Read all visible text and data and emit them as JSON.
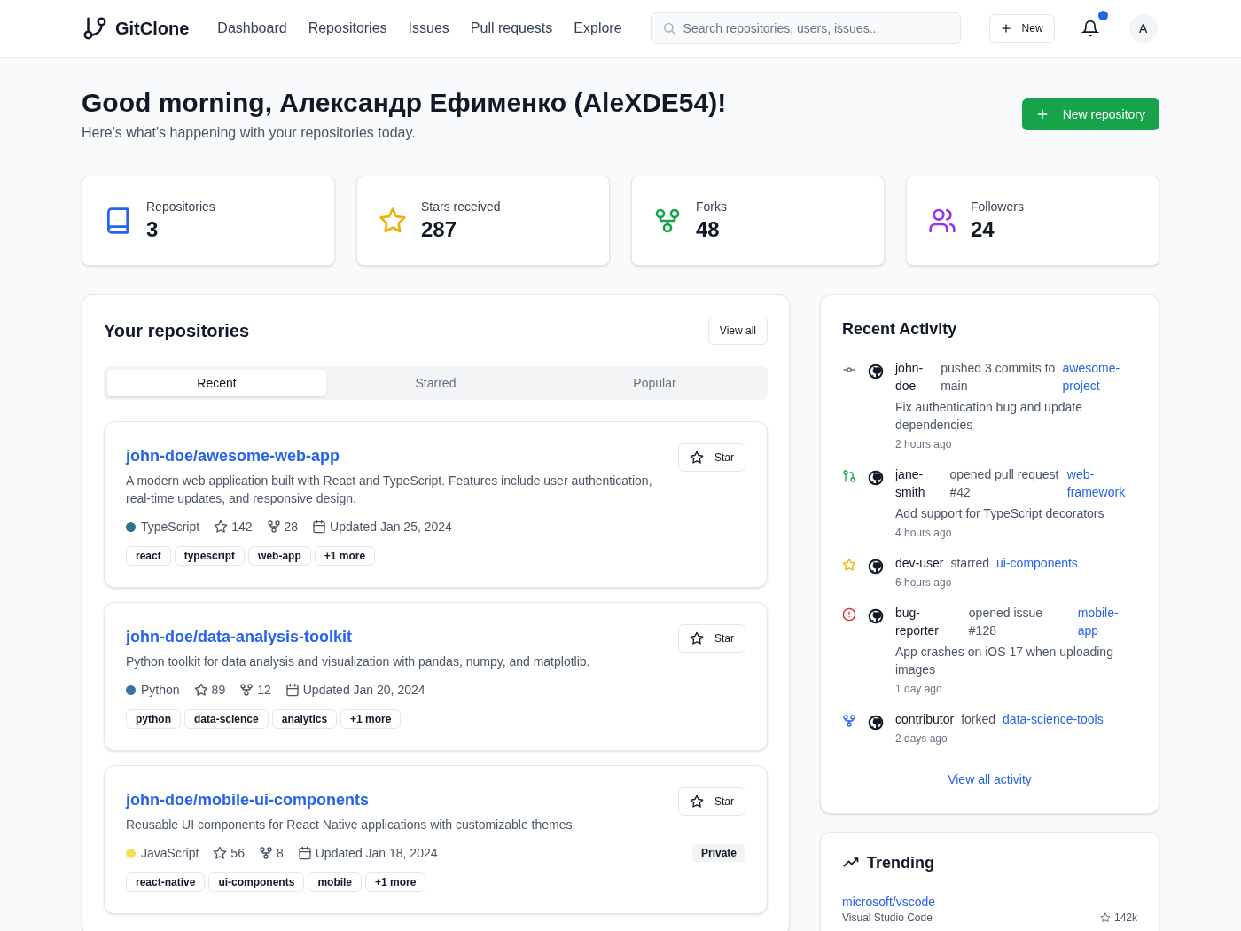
{
  "header": {
    "brand": "GitClone",
    "nav": [
      {
        "label": "Dashboard"
      },
      {
        "label": "Repositories"
      },
      {
        "label": "Issues"
      },
      {
        "label": "Pull requests"
      },
      {
        "label": "Explore"
      }
    ],
    "search": {
      "placeholder": "Search repositories, users, issues..."
    },
    "new_button": "New",
    "notifications": {
      "unread": true
    },
    "avatar": "A"
  },
  "greeting": {
    "title": "Good morning, Александр Ефименко (AleXDE54)!",
    "subtitle": "Here's what's happening with your repositories today.",
    "new_repo_button": "New repository"
  },
  "stats": [
    {
      "kind": "book",
      "label": "Repositories",
      "value": "3",
      "color": "#2563eb"
    },
    {
      "kind": "star",
      "label": "Stars received",
      "value": "287",
      "color": "#eab308"
    },
    {
      "kind": "fork",
      "label": "Forks",
      "value": "48",
      "color": "#16a34a"
    },
    {
      "kind": "users",
      "label": "Followers",
      "value": "24",
      "color": "#9333ea"
    }
  ],
  "repositories": {
    "title": "Your repositories",
    "view_all": "View all",
    "tabs": [
      {
        "label": "Recent",
        "selected": true
      },
      {
        "label": "Starred",
        "selected": false
      },
      {
        "label": "Popular",
        "selected": false
      }
    ],
    "items": [
      {
        "name": "john-doe/awesome-web-app",
        "description": "A modern web application built with React and TypeScript. Features include user authentication, real-time updates, and responsive design.",
        "star_button": "Star",
        "language": "TypeScript",
        "color": "#2b7489",
        "stars": "142",
        "forks": "28",
        "updated": "Updated Jan 25, 2024",
        "private": false,
        "topics": [
          "react",
          "typescript",
          "web-app",
          "+1 more"
        ]
      },
      {
        "name": "john-doe/data-analysis-toolkit",
        "description": "Python toolkit for data analysis and visualization with pandas, numpy, and matplotlib.",
        "star_button": "Star",
        "language": "Python",
        "color": "#3572a5",
        "stars": "89",
        "forks": "12",
        "updated": "Updated Jan 20, 2024",
        "private": false,
        "topics": [
          "python",
          "data-science",
          "analytics",
          "+1 more"
        ]
      },
      {
        "name": "john-doe/mobile-ui-components",
        "description": "Reusable UI components for React Native applications with customizable themes.",
        "star_button": "Star",
        "language": "JavaScript",
        "color": "#f1e05a",
        "stars": "56",
        "forks": "8",
        "updated": "Updated Jan 18, 2024",
        "private": true,
        "private_label": "Private",
        "topics": [
          "react-native",
          "ui-components",
          "mobile",
          "+1 more"
        ]
      }
    ]
  },
  "activity": {
    "title": "Recent Activity",
    "view_all": "View all activity",
    "items": [
      {
        "kind": "commit",
        "user": "john-doe",
        "action": "pushed 3 commits to main",
        "target": "awesome-project",
        "detail": "Fix authentication bug and update dependencies",
        "time": "2 hours ago"
      },
      {
        "kind": "pull",
        "user": "jane-smith",
        "action": "opened pull request #42",
        "target": "web-framework",
        "detail": "Add support for TypeScript decorators",
        "time": "4 hours ago"
      },
      {
        "kind": "star",
        "user": "dev-user",
        "action": "starred",
        "target": "ui-components",
        "time": "6 hours ago"
      },
      {
        "kind": "issue",
        "user": "bug-reporter",
        "action": "opened issue #128",
        "target": "mobile-app",
        "detail": "App crashes on iOS 17 when uploading images",
        "time": "1 day ago"
      },
      {
        "kind": "fork",
        "user": "contributor",
        "action": "forked",
        "target": "data-science-tools",
        "time": "2 days ago"
      }
    ]
  },
  "trending": {
    "title": "Trending",
    "items": [
      {
        "name": "microsoft/vscode",
        "description": "Visual Studio Code",
        "stars": "142k"
      }
    ]
  }
}
